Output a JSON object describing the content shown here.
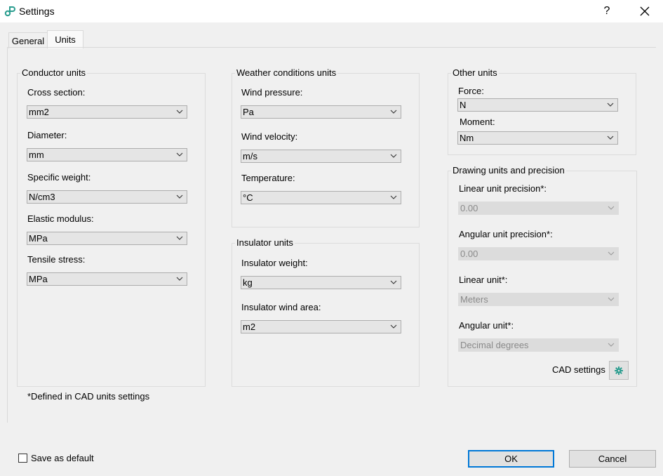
{
  "window": {
    "title": "Settings",
    "help": "?",
    "close": "✕"
  },
  "tabs": [
    {
      "label": "General",
      "selected": false
    },
    {
      "label": "Units",
      "selected": true
    }
  ],
  "conductor": {
    "title": "Conductor units",
    "cross_section_label": "Cross section:",
    "cross_section_value": "mm2",
    "diameter_label": "Diameter:",
    "diameter_value": "mm",
    "specific_weight_label": "Specific weight:",
    "specific_weight_value": "N/cm3",
    "elastic_modulus_label": "Elastic modulus:",
    "elastic_modulus_value": "MPa",
    "tensile_stress_label": "Tensile stress:",
    "tensile_stress_value": "MPa"
  },
  "weather": {
    "title": "Weather conditions units",
    "wind_pressure_label": "Wind pressure:",
    "wind_pressure_value": "Pa",
    "wind_velocity_label": "Wind velocity:",
    "wind_velocity_value": "m/s",
    "temperature_label": "Temperature:",
    "temperature_value": "°C"
  },
  "insulator": {
    "title": "Insulator units",
    "weight_label": "Insulator weight:",
    "weight_value": "kg",
    "wind_area_label": "Insulator wind area:",
    "wind_area_value": "m2"
  },
  "other": {
    "title": "Other units",
    "force_label": "Force:",
    "force_value": "N",
    "moment_label": "Moment:",
    "moment_value": "Nm"
  },
  "drawing": {
    "title": "Drawing units and precision",
    "linear_precision_label": "Linear unit precision*:",
    "linear_precision_value": "0.00",
    "angular_precision_label": "Angular unit precision*:",
    "angular_precision_value": "0.00",
    "linear_unit_label": "Linear unit*:",
    "linear_unit_value": "Meters",
    "angular_unit_label": "Angular unit*:",
    "angular_unit_value": "Decimal degrees",
    "cad_settings_label": "CAD settings"
  },
  "footnote": "*Defined in CAD units settings",
  "footer": {
    "save_default_label": "Save as default",
    "save_default_checked": false,
    "ok_label": "OK",
    "cancel_label": "Cancel"
  },
  "colors": {
    "accent": "#0078d7",
    "app_icon": "#2a9d8f"
  }
}
